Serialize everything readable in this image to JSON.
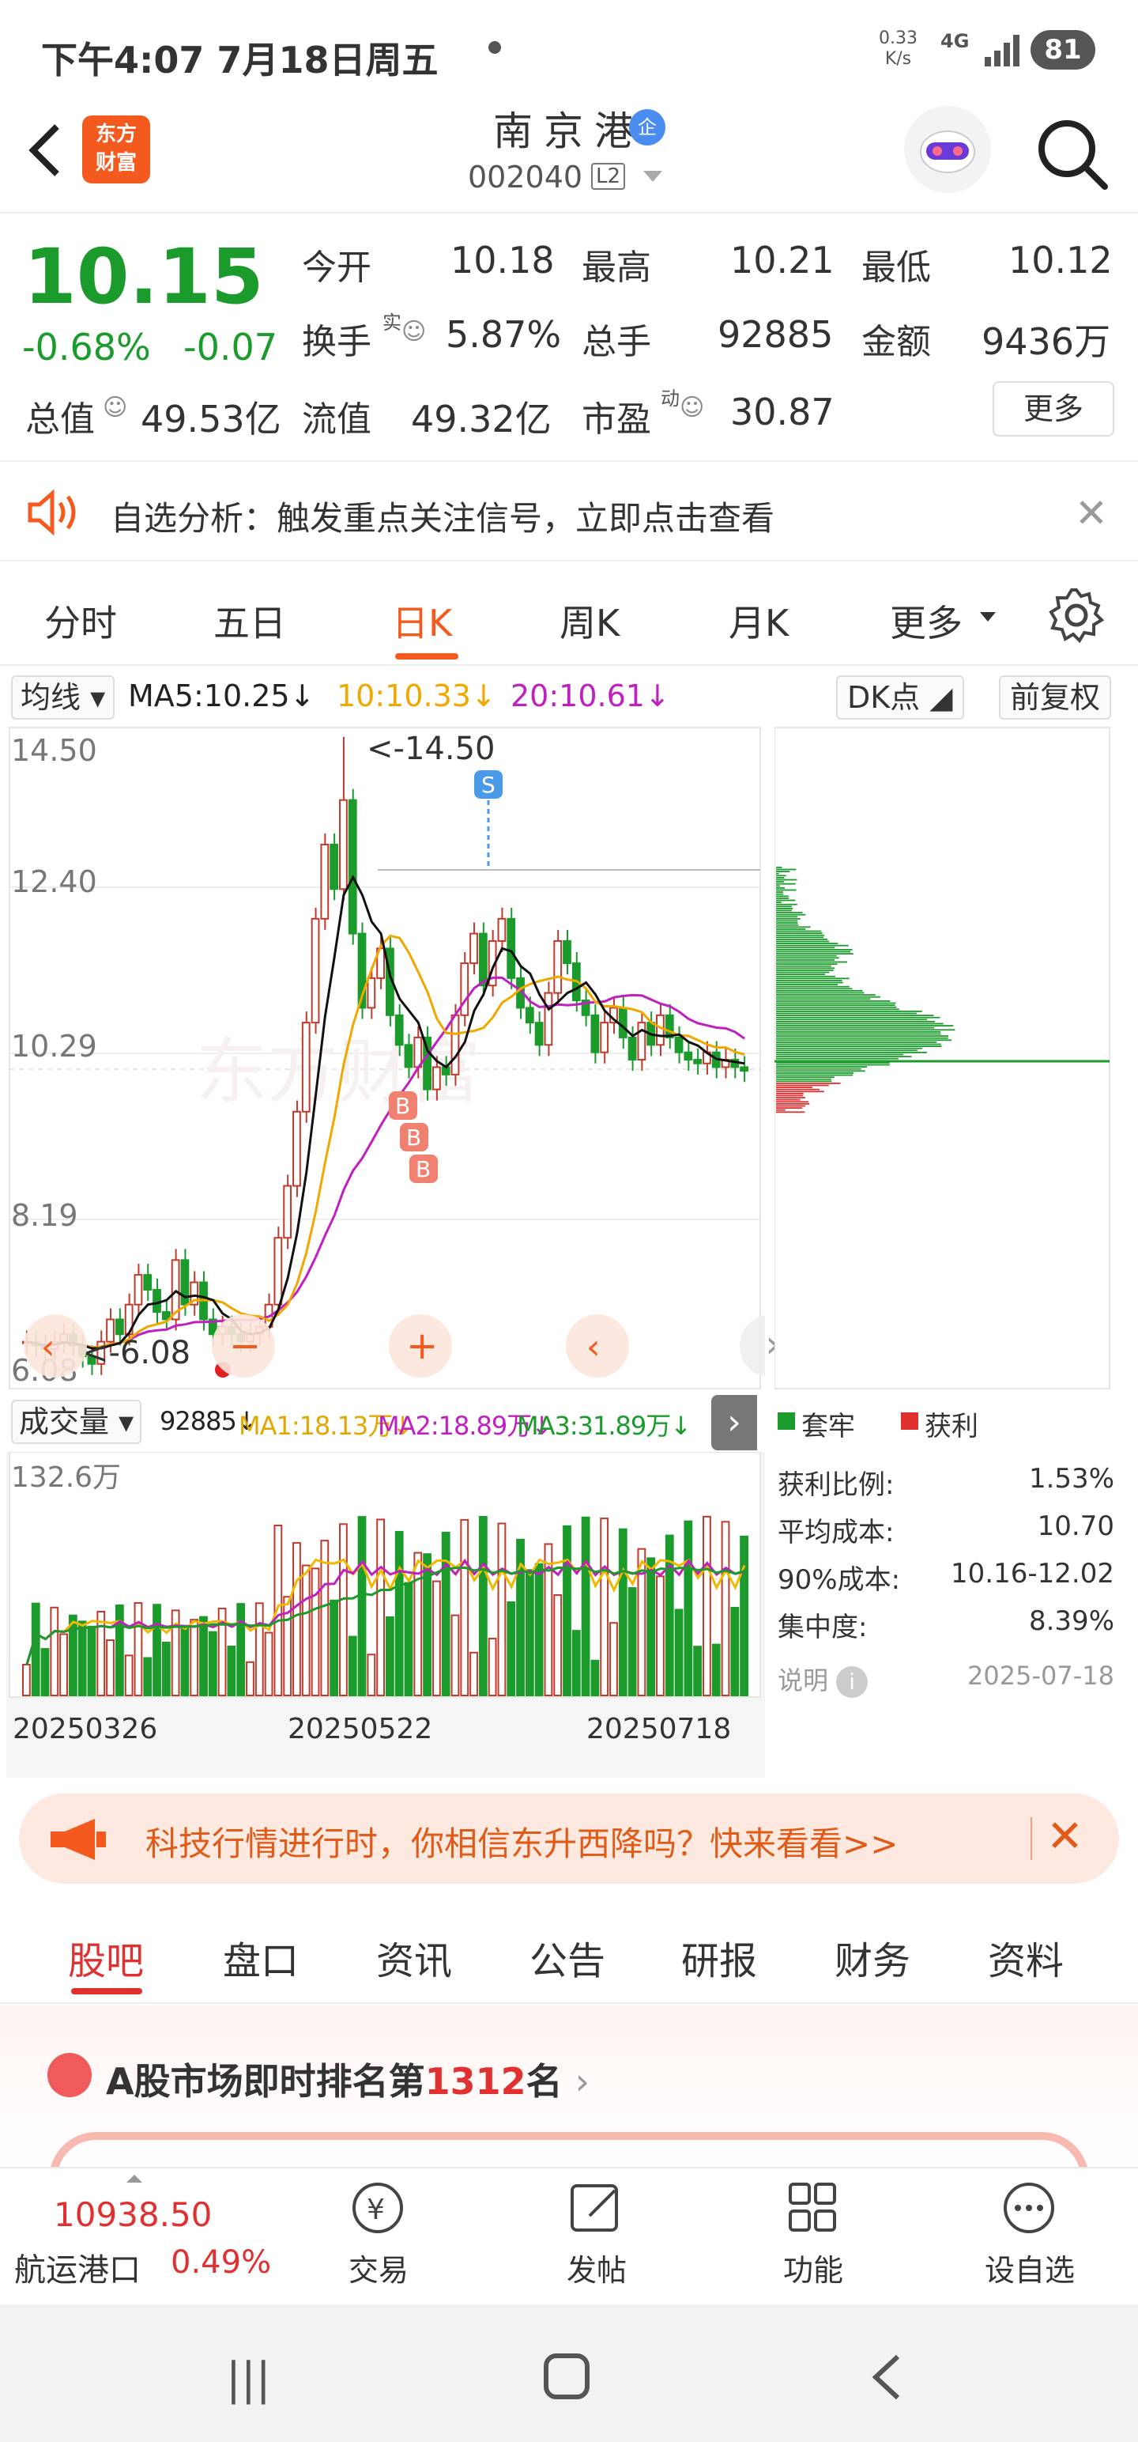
{
  "status": {
    "time": "下午4:07  7月18日周五",
    "net_speed": "0.33\nK/s",
    "signal": "4G",
    "battery": "81"
  },
  "header": {
    "logo": "东方\n财富",
    "stock_name": "南京港",
    "badge": "企",
    "code": "002040",
    "level": "L2"
  },
  "quote": {
    "price": "10.15",
    "change_pct": "-0.68%",
    "change_val": "-0.07",
    "open_label": "今开",
    "open": "10.18",
    "high_label": "最高",
    "high": "10.21",
    "low_label": "最低",
    "low": "10.12",
    "turnover_label": "换手",
    "turnover_sup": "实",
    "turnover": "5.87%",
    "volume_label": "总手",
    "volume": "92885",
    "amount_label": "金额",
    "amount": "9436万",
    "mktcap_label": "总值",
    "mktcap": "49.53亿",
    "float_label": "流值",
    "float": "49.32亿",
    "pe_label": "市盈",
    "pe_sup": "动",
    "pe": "30.87",
    "more": "更多"
  },
  "notice": {
    "text": "自选分析：触发重点关注信号，立即点击查看"
  },
  "chart_tabs": {
    "items": [
      "分时",
      "五日",
      "日K",
      "周K",
      "月K",
      "更多"
    ],
    "active": "日K"
  },
  "ma": {
    "selector": "均线",
    "ma5": "MA5:10.25",
    "ma10": "10:10.33",
    "ma20": "20:10.61",
    "dk": "DK点",
    "adjust": "前复权",
    "colors": {
      "ma5": "#111111",
      "ma10": "#f0a800",
      "ma20": "#c020c0",
      "up": "#c0392b",
      "down": "#1a9b2b"
    }
  },
  "kchart": {
    "y_labels": [
      "14.50",
      "12.40",
      "10.29",
      "8.19",
      "6.08"
    ],
    "high_marker": "<-14.50",
    "low_marker": "<-6.08",
    "s_marker": "S",
    "b_marker": "B",
    "watermark": "东方财富"
  },
  "volume": {
    "selector": "成交量",
    "value": "92885",
    "ma1": "MA1:18.13万",
    "ma2": "MA2:18.89万",
    "ma3": "MA3:31.89万",
    "max_label": "132.6万",
    "dates": [
      "20250326",
      "20250522",
      "20250718"
    ]
  },
  "chip": {
    "legend_trap": "套牢",
    "legend_profit": "获利",
    "rows": [
      {
        "label": "获利比例:",
        "value": "1.53%"
      },
      {
        "label": "平均成本:",
        "value": "10.70"
      },
      {
        "label": "90%成本:",
        "value": "10.16-12.02"
      },
      {
        "label": "集中度:",
        "value": "8.39%"
      }
    ],
    "note_label": "说明",
    "note_date": "2025-07-18"
  },
  "ad": {
    "text": "科技行情进行时，你相信东升西降吗？快来看看>>"
  },
  "info_tabs": {
    "items": [
      "股吧",
      "盘口",
      "资讯",
      "公告",
      "研报",
      "财务",
      "资料"
    ],
    "active": "股吧"
  },
  "rank": {
    "prefix": "A股市场即时排名第",
    "num": "1312",
    "suffix": "名"
  },
  "dock": {
    "index_value": "10938.50",
    "index_name": "航运港口",
    "index_pct": "0.49%",
    "items": [
      "交易",
      "发帖",
      "功能",
      "设自选"
    ]
  },
  "chart_data": {
    "type": "candlestick",
    "y_range": [
      6.08,
      14.5
    ],
    "x_dates": [
      "20250326",
      "20250522",
      "20250718"
    ],
    "notes": "Daily K-line with MA5/MA10/MA20; volume pane max 132.6万"
  }
}
